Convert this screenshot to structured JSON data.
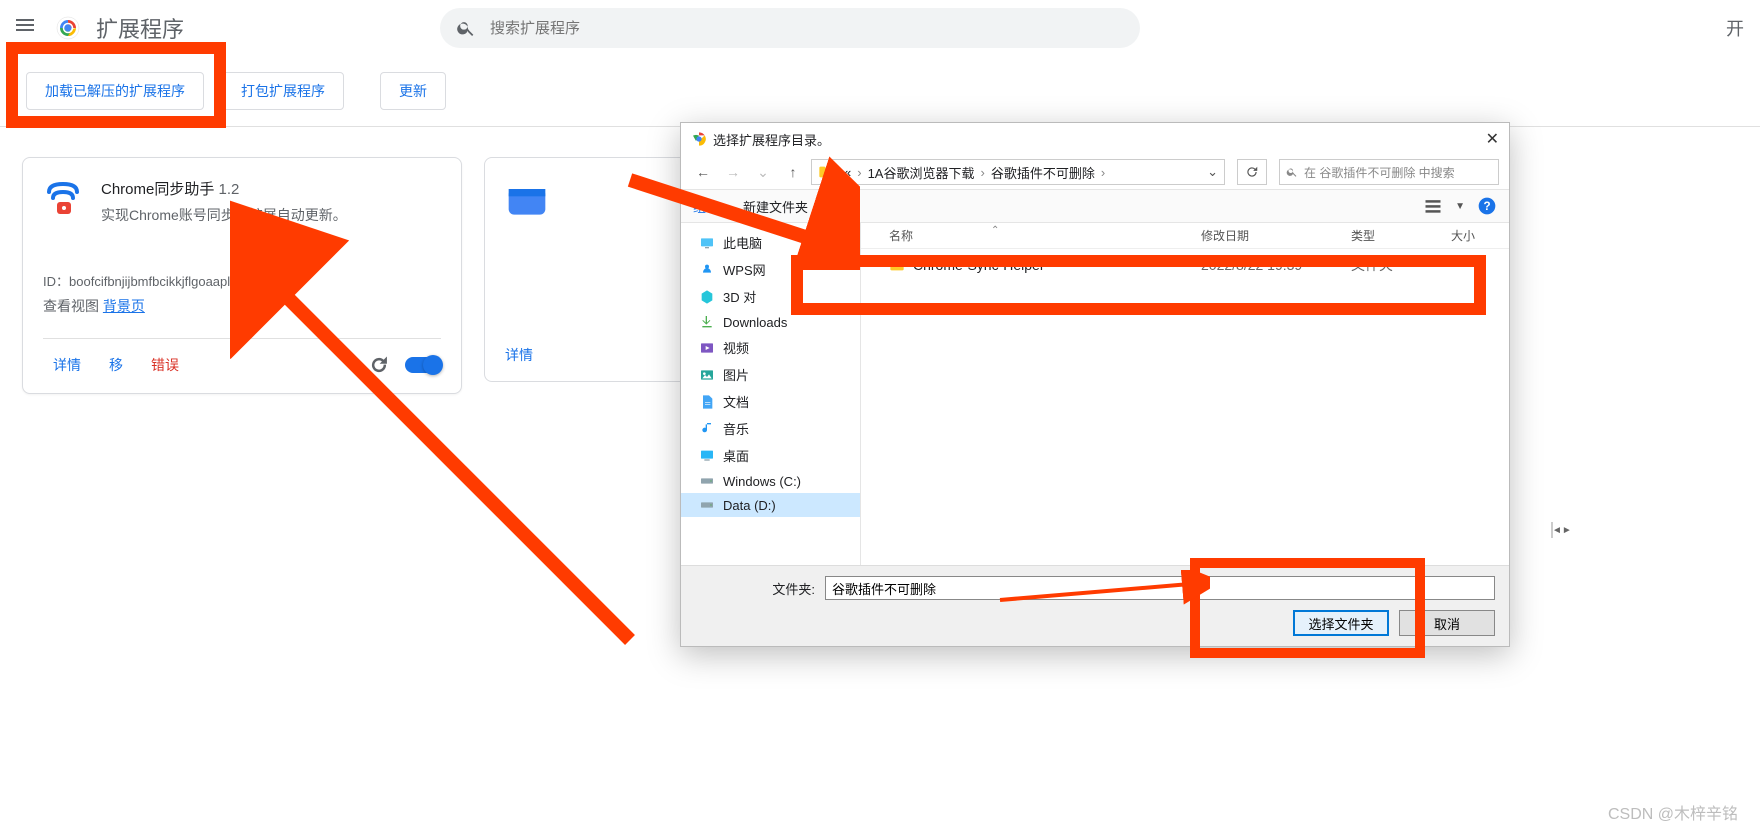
{
  "header": {
    "page_title": "扩展程序",
    "search_placeholder": "搜索扩展程序"
  },
  "toolbar": {
    "load_unpacked": "加载已解压的扩展程序",
    "pack": "打包扩展程序",
    "update": "更新"
  },
  "ext_card": {
    "name": "Chrome同步助手",
    "version": "1.2",
    "desc": "实现Chrome账号同步和扩展自动更新。",
    "id_prefix": "ID：",
    "id_value": "boofcifbnjijbmfbcikkjflgoaaplfbc",
    "view_label": "查看视图",
    "bg_link": "背景页",
    "details": "详情",
    "remove": "移",
    "errors": "错误"
  },
  "card2": {
    "details": "详情"
  },
  "dialog": {
    "title": "选择扩展程序目录。",
    "path_seg1": "1A谷歌浏览器下载",
    "path_seg2": "谷歌插件不可删除",
    "path_prefix": "«",
    "search_placeholder": "在 谷歌插件不可删除 中搜索",
    "organize": "组织",
    "newfolder": "新建文件夹",
    "columns": {
      "name": "名称",
      "date": "修改日期",
      "type": "类型",
      "size": "大小"
    },
    "side": {
      "pc": "此电脑",
      "wps": "WPS网",
      "d3": "3D 对",
      "downloads": "Downloads",
      "video": "视频",
      "pictures": "图片",
      "docs": "文档",
      "music": "音乐",
      "desktop": "桌面",
      "cdrive": "Windows (C:)",
      "ddrive": "Data (D:)"
    },
    "row": {
      "name": "Chrome-Sync-Helper",
      "date": "2022/8/22 19:39",
      "type": "文件夹"
    },
    "footer": {
      "label": "文件夹:",
      "value": "谷歌插件不可删除",
      "select": "选择文件夹",
      "cancel": "取消"
    }
  },
  "watermark": "CSDN @木梓辛铭"
}
